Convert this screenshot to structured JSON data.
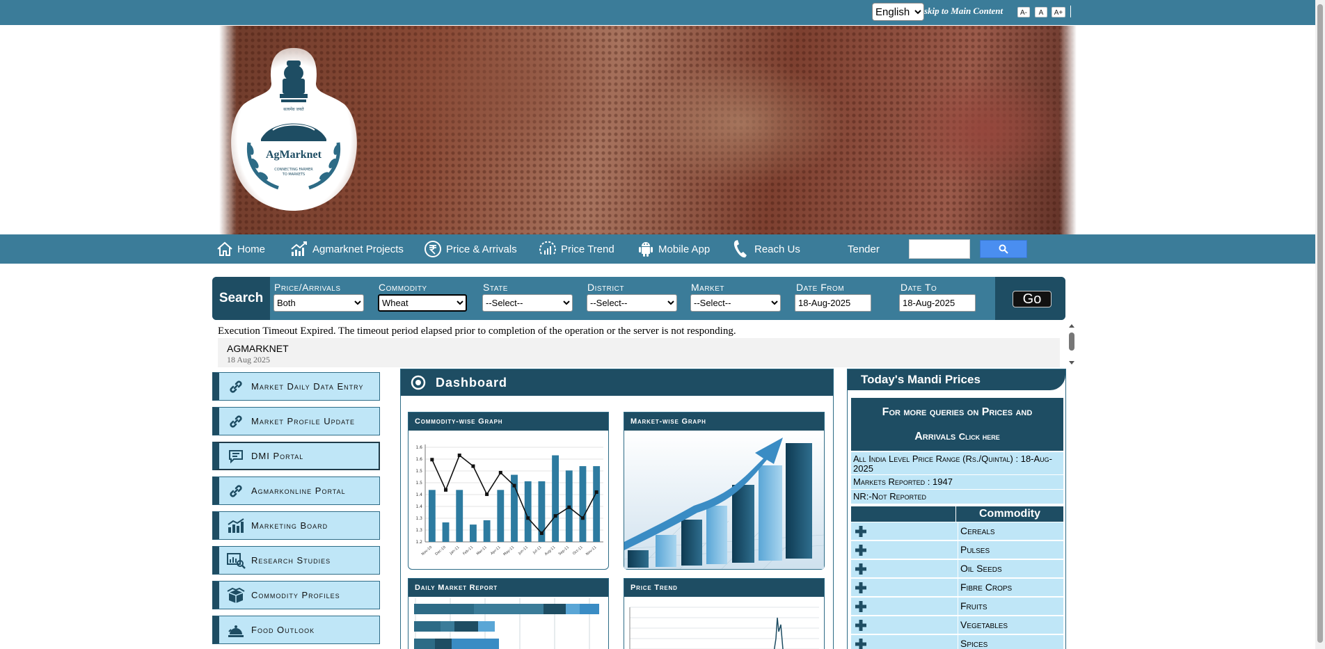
{
  "topbar": {
    "language": "English",
    "skip_link": "skip to Main Content",
    "font_buttons": [
      "A-",
      "A",
      "A+"
    ]
  },
  "nav": {
    "items": [
      {
        "label": "Home",
        "icon": "home-icon"
      },
      {
        "label": "Agmarknet Projects",
        "icon": "chart-trend-icon"
      },
      {
        "label": "Price & Arrivals",
        "icon": "rupee-icon"
      },
      {
        "label": "Price Trend",
        "icon": "gauge-icon"
      },
      {
        "label": "Mobile App",
        "icon": "android-icon"
      },
      {
        "label": "Reach Us",
        "icon": "phone-icon"
      },
      {
        "label": "Tender",
        "icon": ""
      }
    ]
  },
  "search": {
    "label": "Search",
    "fields": [
      {
        "label": "Price/Arrivals",
        "value": "Both"
      },
      {
        "label": "Commodity",
        "value": "Wheat"
      },
      {
        "label": "State",
        "value": "--Select--"
      },
      {
        "label": "District",
        "value": "--Select--"
      },
      {
        "label": "Market",
        "value": "--Select--"
      }
    ],
    "date_from_label": "Date From",
    "date_from": "18-Aug-2025",
    "date_to_label": "Date To",
    "date_to": "18-Aug-2025",
    "go_label": "Go"
  },
  "error_message": "Execution Timeout Expired. The timeout period elapsed prior to completion of the operation or the server is not responding.",
  "ticker": {
    "title": "AGMARKNET",
    "date": "18 Aug 2025"
  },
  "left_menu": [
    {
      "label": "Market Daily Data Entry",
      "icon": "link-icon"
    },
    {
      "label": "Market Profile Update",
      "icon": "link-icon"
    },
    {
      "label": "DMI Portal",
      "icon": "chat-icon"
    },
    {
      "label": "Agmarkonline Portal",
      "icon": "link-icon"
    },
    {
      "label": "Marketing Board",
      "icon": "bar-chart-icon"
    },
    {
      "label": "Research Studies",
      "icon": "research-icon"
    },
    {
      "label": "Commodity Profiles",
      "icon": "box-icon"
    },
    {
      "label": "Food Outlook",
      "icon": "food-icon"
    }
  ],
  "dashboard": {
    "title": "Dashboard",
    "cards": [
      {
        "title": "Commodity-wise Graph"
      },
      {
        "title": "Market-wise Graph"
      },
      {
        "title": "Daily Market Report"
      },
      {
        "title": "Price Trend"
      }
    ],
    "commodity_graph": {
      "categories": [
        "Nov-10",
        "Dec-10",
        "Jan-11",
        "Feb-11",
        "Mar-11",
        "Apr-11",
        "May-11",
        "Jun-11",
        "Jul-11",
        "Aug-11",
        "Sep-11",
        "Oct-11",
        "Nov-11"
      ],
      "y_ticks": [
        "1.6",
        "1.6",
        "1.5",
        "1.5",
        "1.4",
        "1.4",
        "1.3",
        "1.3",
        "1.2"
      ],
      "bars": [
        1.44,
        1.29,
        1.44,
        1.28,
        1.3,
        1.44,
        1.51,
        1.48,
        1.48,
        1.6,
        1.53,
        1.55,
        1.55
      ],
      "line": [
        1.58,
        1.44,
        1.6,
        1.55,
        1.42,
        1.52,
        1.46,
        1.31,
        1.24,
        1.32,
        1.36,
        1.31,
        1.43
      ]
    }
  },
  "mandi": {
    "title": "Today's Mandi Prices",
    "queries_line1": "For more queries on Prices and",
    "queries_line2": "Arrivals",
    "queries_click": "Click here",
    "range_label": "All India Level Price Range (Rs./Quintal) : 18-Aug-2025",
    "markets_reported": "Markets Reported : 1947",
    "nr_note": "NR:-Not Reported",
    "table_header": "Commodity",
    "categories": [
      "Cereals",
      "Pulses",
      "Oil Seeds",
      "Fibre Crops",
      "Fruits",
      "Vegetables",
      "Spices"
    ]
  },
  "colors": {
    "brand": "#3b7c99",
    "dark": "#1e4d63",
    "light": "#bfe6f7"
  }
}
